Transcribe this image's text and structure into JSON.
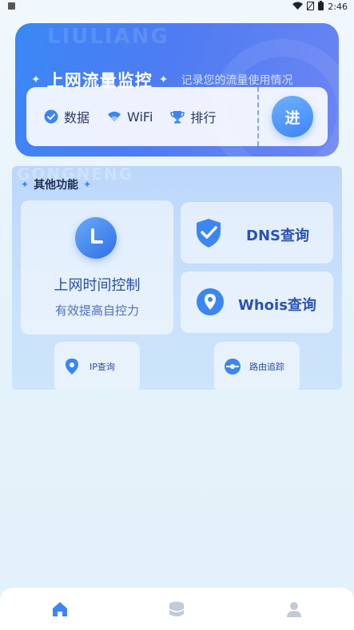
{
  "status_bar": {
    "time": "2:46",
    "icons": [
      "notification-icon",
      "wifi-icon",
      "no-sim-icon",
      "battery-icon"
    ]
  },
  "header": {
    "watermark": "LIULIANG",
    "title": "上网流量监控",
    "subtitle": "记录您的流量使用情况",
    "stats": [
      {
        "label": "数据",
        "icon": "data-check-icon"
      },
      {
        "label": "WiFi",
        "icon": "wifi-icon"
      },
      {
        "label": "排行",
        "icon": "trophy-icon"
      }
    ],
    "enter_label": "进"
  },
  "features": {
    "watermark": "GONGNENG",
    "title": "其他功能",
    "time_control": {
      "title": "上网时间控制",
      "subtitle": "有效提高自控力"
    },
    "dns": {
      "label": "DNS查询"
    },
    "whois": {
      "label": "Whois查询"
    },
    "ip": {
      "label": "IP查询"
    },
    "route": {
      "label": "路由追踪"
    }
  },
  "bottom_nav": {
    "items": [
      {
        "icon": "home-icon",
        "active": true
      },
      {
        "icon": "stats-icon",
        "active": false
      },
      {
        "icon": "profile-icon",
        "active": false
      }
    ]
  },
  "colors": {
    "accent": "#3c86f3",
    "header_start": "#3a87f6",
    "header_end": "#6d85f3",
    "text_dark": "#1f2d55",
    "text_blue": "#2c52b5"
  }
}
